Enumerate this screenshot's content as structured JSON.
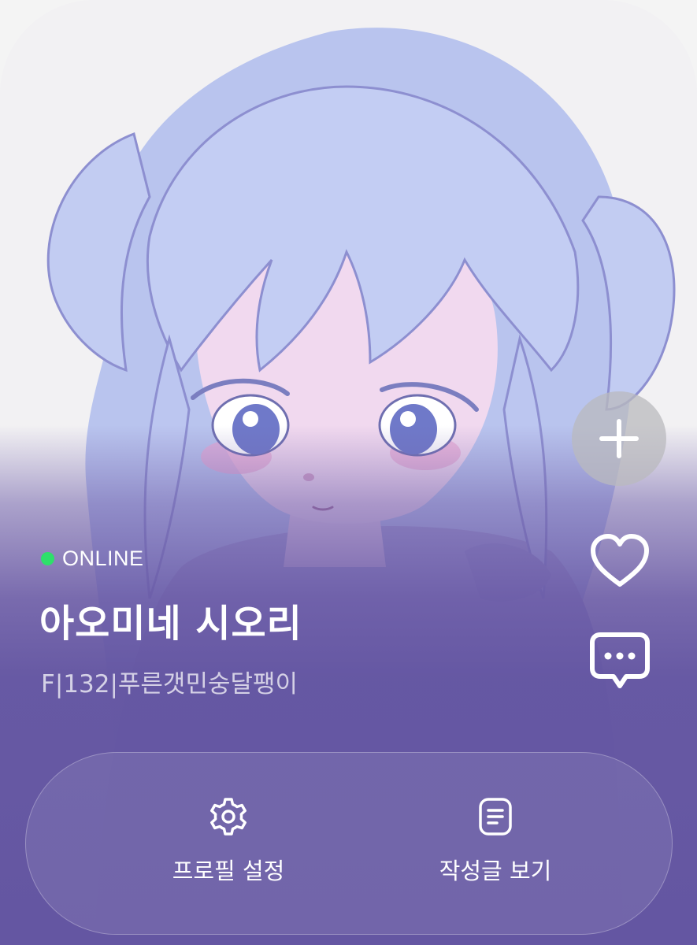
{
  "profile": {
    "status": "ONLINE",
    "status_color": "#2ee06a",
    "name": "아오미네 시오리",
    "bio": "F|132|푸른갯민숭달팽이"
  },
  "side_actions": {
    "add_icon": "plus-icon",
    "like_icon": "heart-icon",
    "chat_icon": "chat-bubble-icon"
  },
  "actions": {
    "profile_settings_label": "프로필 설정",
    "profile_settings_icon": "gear-icon",
    "view_posts_label": "작성글 보기",
    "view_posts_icon": "document-icon"
  },
  "theme": {
    "accent": "#6456a2",
    "hair": "#b6c3ef"
  }
}
